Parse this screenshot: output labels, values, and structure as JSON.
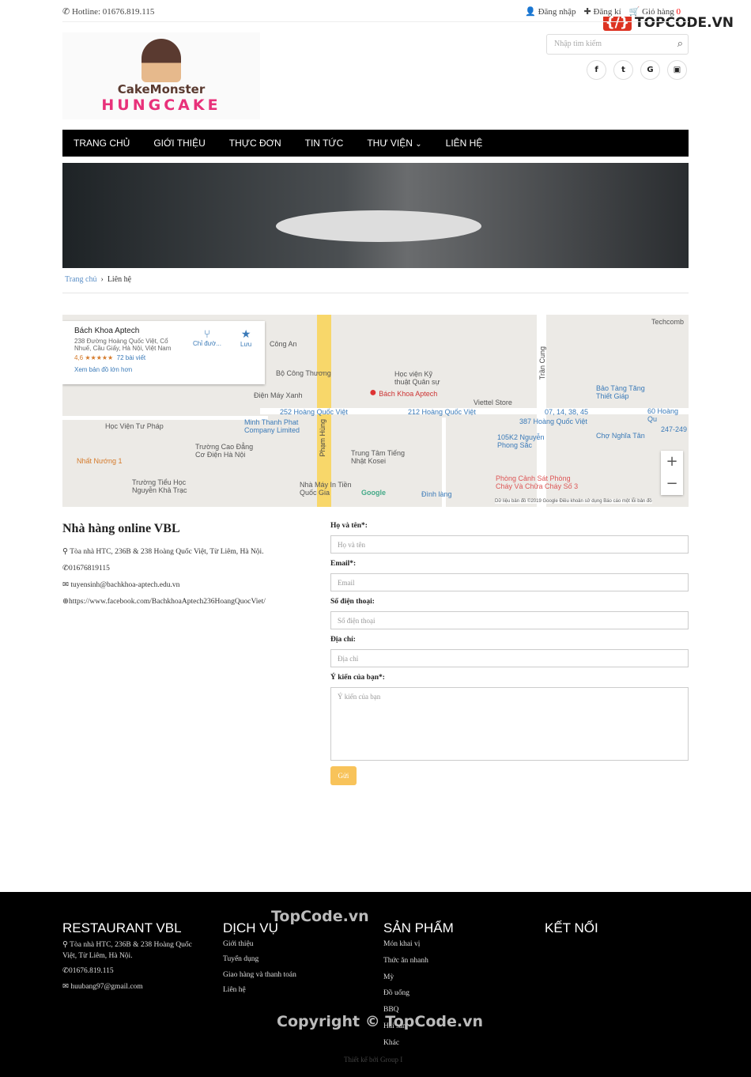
{
  "topbar": {
    "hotline": "Hotline: 01676.819.115",
    "login": "Đăng nhập",
    "register": "Đăng kí",
    "cart": "Giỏ hàng",
    "cart_count": "0",
    "watermark": "TOPCODE.VN"
  },
  "logo": {
    "line1": "CakeMonster",
    "line2": "HUNGCAKE"
  },
  "search": {
    "placeholder": "Nhập tìm kiếm"
  },
  "social": [
    "f",
    "t",
    "G",
    "yt"
  ],
  "nav": [
    "TRANG CHỦ",
    "GIỚI THIỆU",
    "THỰC ĐƠN",
    "TIN TỨC",
    "THƯ VIỆN",
    "LIÊN HỆ"
  ],
  "breadcrumb": {
    "home": "Trang chủ",
    "current": "Liên hệ"
  },
  "map": {
    "name": "Bách Khoa Aptech",
    "address": "238 Đường Hoàng Quốc Việt, Cổ Nhuế, Cầu Giấy, Hà Nội, Việt Nam",
    "rating": "4,6 ★★★★★",
    "reviews": "72 bài viết",
    "larger": "Xem bản đồ lớn hơn",
    "directions": "Chỉ đườ...",
    "save": "Lưu",
    "labels": [
      "Công An",
      "Bộ Công Thương",
      "Điện Máy Xanh",
      "252 Hoàng Quốc Việt",
      "Minh Thanh Phat Company Limited",
      "Học Viện Tư Pháp",
      "Trường Cao Đẳng Cơ Điện Hà Nội",
      "Nhất Nướng 1",
      "Trường Tiểu Học Nguyễn Khả Trạc",
      "Phạm Hùng",
      "Học viện Kỹ thuật Quân sự",
      "Bách Khoa Aptech",
      "212 Hoàng Quốc Việt",
      "Trung Tâm Tiếng Nhật Kosei",
      "Nhà Máy In Tiền Quốc Gia",
      "Viettel Store",
      "105K2 Nguyễn Phong Sắc",
      "Đình làng",
      "387 Hoàng Quốc Việt",
      "07, 14, 38, 45",
      "Chợ Nghĩa Tân",
      "Bảo Tàng Tăng Thiết Giáp",
      "60 Hoàng Qu",
      "247-249",
      "Phòng Cảnh Sát Phòng Cháy Và Chữa Cháy Số 3",
      "Trần Cung",
      "Techcomb"
    ],
    "footer": "Dữ liệu bản đồ ©2019 Google  Điều khoản sử dụng  Báo cáo một lỗi bản đồ",
    "google": "Google"
  },
  "contact": {
    "title": "Nhà hàng online VBL",
    "address": "Tòa nhà HTC, 236B & 238 Hoàng Quốc Việt, Từ Liêm, Hà Nội.",
    "phone": "01676819115",
    "email": "tuyensinh@bachkhoa-aptech.edu.vn",
    "web": "https://www.facebook.com/BachkhoaAptech236HoangQuocViet/"
  },
  "form": {
    "name_label": "Họ và tên*:",
    "name_ph": "Họ và tên",
    "email_label": "Email*:",
    "email_ph": "Email",
    "phone_label": "Số điện thoại:",
    "phone_ph": "Số điện thoại",
    "addr_label": "Địa chỉ:",
    "addr_ph": "Địa chỉ",
    "msg_label": "Ý kiến của bạn*:",
    "msg_ph": "Ý kiến của bạn",
    "submit": "Gửi"
  },
  "footer": {
    "c1_title": "RESTAURANT VBL",
    "c1_addr": "Tòa nhà HTC, 236B & 238 Hoàng Quốc Việt, Từ Liêm, Hà Nội.",
    "c1_phone": "01676.819.115",
    "c1_email": "huubang97@gmail.com",
    "c2_title": "DỊCH VỤ",
    "c2": [
      "Giới thiệu",
      "Tuyển dụng",
      "Giao hàng và thanh toán",
      "Liên hệ"
    ],
    "c3_title": "SẢN PHẨM",
    "c3": [
      "Món khai vị",
      "Thức ăn nhanh",
      "Mỳ",
      "Đồ uống",
      "BBQ",
      "Hải sản",
      "Khác"
    ],
    "c4_title": "KẾT NỐI",
    "credit": "Thiết kế bởi Group I",
    "wm1": "TopCode.vn",
    "wm2": "Copyright © TopCode.vn"
  }
}
